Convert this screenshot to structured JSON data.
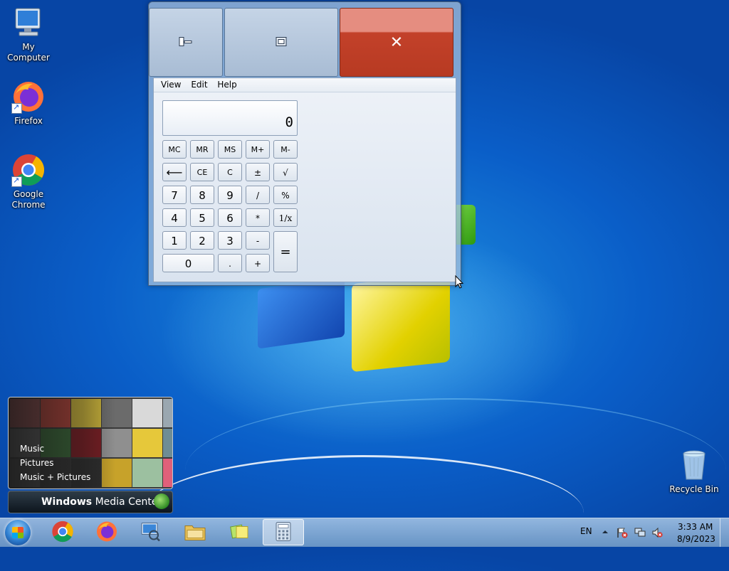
{
  "desktop": {
    "icons": [
      {
        "label": "My Computer"
      },
      {
        "label": "Firefox"
      },
      {
        "label": "Google Chrome"
      },
      {
        "label": "Recycle Bin"
      }
    ]
  },
  "calculator": {
    "menu": [
      "View",
      "Edit",
      "Help"
    ],
    "display_value": "0",
    "buttons": {
      "mc": "MC",
      "mr": "MR",
      "ms": "MS",
      "mplus": "M+",
      "mminus": "M-",
      "backspace": "⟵",
      "ce": "CE",
      "c": "C",
      "plusminus": "±",
      "sqrt": "√",
      "seven": "7",
      "eight": "8",
      "nine": "9",
      "divide": "/",
      "percent": "%",
      "four": "4",
      "five": "5",
      "six": "6",
      "multiply": "*",
      "reciprocal": "1/x",
      "one": "1",
      "two": "2",
      "three": "3",
      "minus": "-",
      "equals": "=",
      "zero": "0",
      "decimal": ".",
      "plus": "+"
    }
  },
  "media_center": {
    "menu": [
      "Music",
      "Pictures",
      "Music + Pictures"
    ],
    "title_bold": "Windows",
    "title_rest": " Media Center"
  },
  "taskbar": {
    "language": "EN",
    "time": "3:33 AM",
    "date": "8/9/2023"
  },
  "colors": {
    "close_button": "#c3412a",
    "wallpaper": "#0a5ec8"
  }
}
